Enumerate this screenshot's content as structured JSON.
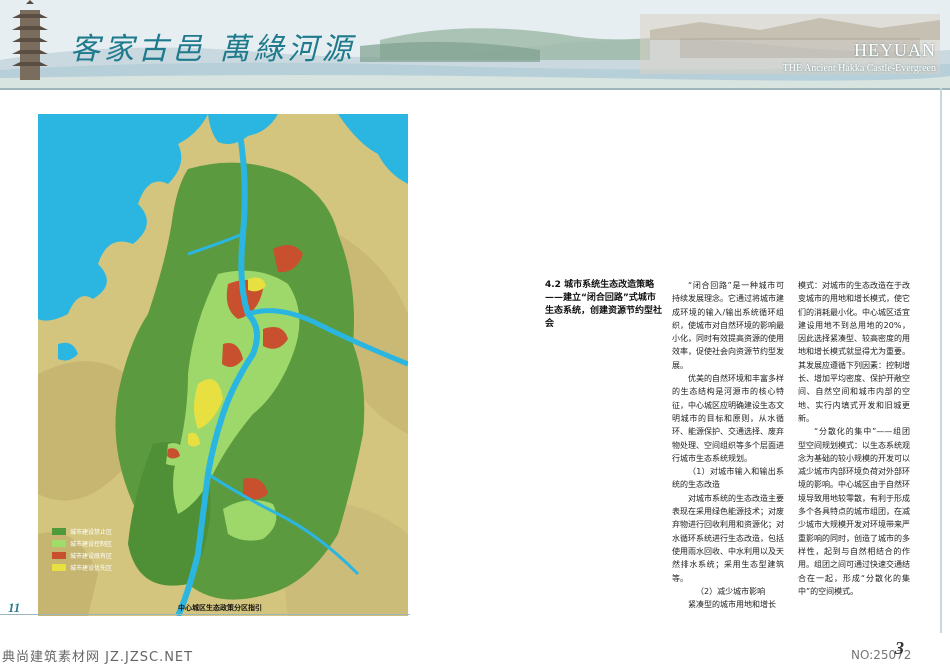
{
  "header": {
    "title_cn": "客家古邑  萬綠河源",
    "title_en": "HEYUAN",
    "subtitle_en": "THE Ancient Hakka Castle-Evergreen"
  },
  "map": {
    "legend": [
      {
        "label": "城市建设禁止区",
        "color": "#4f9a3a"
      },
      {
        "label": "城市建设控制区",
        "color": "#9edd6a"
      },
      {
        "label": "城市建设既有区",
        "color": "#c8502e"
      },
      {
        "label": "城市建设优先区",
        "color": "#e8e040"
      }
    ],
    "caption": "中心城区生态政策分区指引",
    "colors": {
      "water": "#29b5e0",
      "forest": "#5a9a3e",
      "control": "#9ed86a",
      "built": "#c8502e",
      "priority": "#e8e040",
      "terrain": "#d9c77c"
    }
  },
  "page_left": {
    "number": "11"
  },
  "section": {
    "heading": "4.2  城市系统生态改造策略——建立“闭合回路”式城市生态系统，创建资源节约型社会"
  },
  "body": {
    "col1": [
      "“闭合回路”是一种城市可持续发展理念。它通过将城市建成环境的输入/输出系统循环组织，使城市对自然环境的影响最小化，同时有效提高资源的使用效率，促使社会向资源节约型发展。",
      "优美的自然环境和丰富多样的生态结构是河源市的核心特征，中心城区应明确建设生态文明城市的目标和原则，从水循环、能源保护、交通选择、废弃物处理、空间组织等多个层面进行城市生态系统规划。",
      "（1）对城市输入和输出系统的生态改造",
      "对城市系统的生态改造主要表现在采用绿色能源技术；对废弃物进行回收利用和资源化；对水循环系统进行生态改造，包括使用雨水回收、中水利用以及天然排水系统；采用生态型建筑等。",
      "（2）减少城市影响",
      "紧凑型的城市用地和增长"
    ],
    "col2": [
      "模式：对城市的生态改造在于改变城市的用地和增长模式，使它们的消耗最小化。中心城区适宜建设用地不到总用地的20%，因此选择紧凑型、较高密度的用地和增长模式就显得尤为重要。其发展应遵循下列因素：控制增长、增加平均密度、保护开敞空间、自然空间和城市内部的空地、实行内填式开发和旧城更新。",
      "“分散化的集中”——组团型空间规划模式：以生态系统观念为基础的较小规模的开发可以减少城市内部环境负荷对外部环境的影响。中心城区由于自然环境导致用地较零散，有利于形成多个各具特点的城市组团，在减少城市大规模开发对环境带来严重影响的同时，创造了城市的多样性，起到与自然相结合的作用。组团之间可通过快速交通结合在一起，形成“分散化的集中”的空间模式。"
    ]
  },
  "footer": {
    "watermark_left": "典尚建筑素材网 JZ.JZSC.NET",
    "watermark_right": "NO:25072",
    "page_right": "3"
  }
}
